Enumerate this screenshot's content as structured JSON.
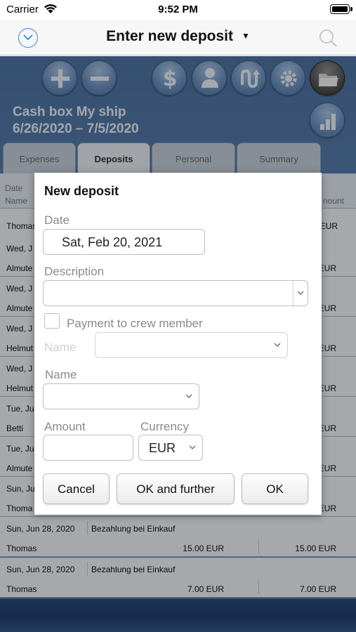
{
  "status_bar": {
    "carrier": "Carrier",
    "time": "9:52 PM"
  },
  "nav": {
    "title": "Enter new deposit"
  },
  "cashbox": {
    "name": "Cash box My ship",
    "dates": "6/26/2020 – 7/5/2020"
  },
  "tabs": [
    {
      "label": "Expenses"
    },
    {
      "label": "Deposits"
    },
    {
      "label": "Personal"
    },
    {
      "label": "Summary"
    }
  ],
  "table": {
    "header": {
      "date": "Date",
      "name": "Name",
      "amount": "nount"
    },
    "rows": [
      {
        "date": "",
        "desc": "",
        "name": "Thomas",
        "amount": "",
        "currency": "EUR",
        "total": ""
      },
      {
        "date": "Wed, J",
        "desc": "",
        "name": "Almute",
        "amount": "",
        "currency": "EUR",
        "total": ""
      },
      {
        "date": "Wed, J",
        "desc": "",
        "name": "Almute",
        "amount": "",
        "currency": "EUR",
        "total": ""
      },
      {
        "date": "Wed, J",
        "desc": "",
        "name": "Helmut",
        "amount": "",
        "currency": "EUR",
        "total": ""
      },
      {
        "date": "Wed, J",
        "desc": "",
        "name": "Helmut",
        "amount": "",
        "currency": "EUR",
        "total": ""
      },
      {
        "date": "Tue, Ju",
        "desc": "",
        "name": "Betti",
        "amount": "",
        "currency": "EUR",
        "total": ""
      },
      {
        "date": "Tue, Ju",
        "desc": "",
        "name": "Almute",
        "amount": "",
        "currency": "EUR",
        "total": ""
      },
      {
        "date": "Sun, Ju",
        "desc": "",
        "name": "Thoma",
        "amount": "",
        "currency": "EUR",
        "total": ""
      },
      {
        "date": "Sun, Jun 28, 2020",
        "desc": "Bezahlung bei Einkauf",
        "name": "Thomas",
        "amount": "15.00  EUR",
        "currency": "",
        "total": "15.00  EUR"
      },
      {
        "date": "Sun, Jun 28, 2020",
        "desc": "Bezahlung bei Einkauf",
        "name": "Thomas",
        "amount": "7.00  EUR",
        "currency": "",
        "total": "7.00  EUR"
      }
    ]
  },
  "dialog": {
    "title": "New deposit",
    "date_label": "Date",
    "date_value": "Sat, Feb 20, 2021",
    "description_label": "Description",
    "description_value": "",
    "crew_checkbox_label": "Payment to crew member",
    "crew_name_label": "Name",
    "name_label": "Name",
    "amount_label": "Amount",
    "amount_value": "",
    "currency_label": "Currency",
    "currency_value": "EUR",
    "buttons": {
      "cancel": "Cancel",
      "ok_further": "OK and further",
      "ok": "OK"
    }
  }
}
